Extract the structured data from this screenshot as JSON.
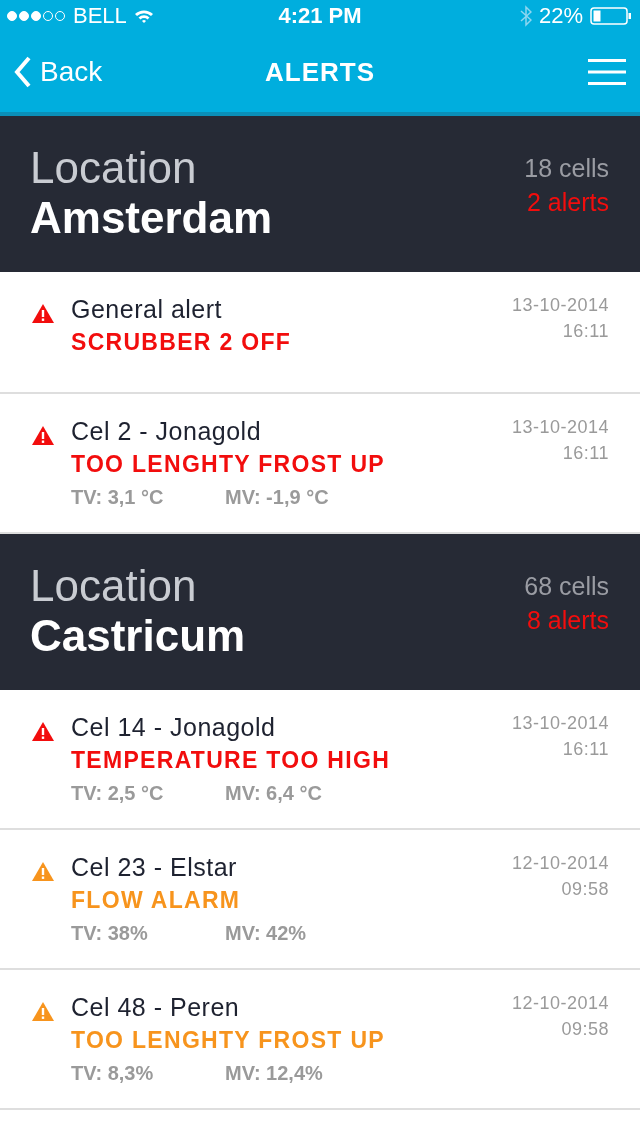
{
  "status_bar": {
    "carrier": "BELL",
    "time": "4:21 PM",
    "battery": "22%"
  },
  "nav": {
    "back": "Back",
    "title": "ALERTS"
  },
  "locations": [
    {
      "label": "Location",
      "name": "Amsterdam",
      "cells": "18 cells",
      "alerts": "2 alerts",
      "items": [
        {
          "kind": "critical",
          "title": "General alert",
          "message": "SCRUBBER 2 OFF",
          "date": "13-10-2014",
          "time": "16:11"
        },
        {
          "kind": "critical",
          "title": "Cel 2 - Jonagold",
          "message": "TOO LENGHTY FROST UP",
          "tv": "TV: 3,1 °C",
          "mv": "MV: -1,9 °C",
          "date": "13-10-2014",
          "time": "16:11"
        }
      ]
    },
    {
      "label": "Location",
      "name": "Castricum",
      "cells": "68 cells",
      "alerts": "8 alerts",
      "items": [
        {
          "kind": "critical",
          "title": "Cel 14 - Jonagold",
          "message": "TEMPERATURE TOO HIGH",
          "tv": "TV: 2,5 °C",
          "mv": "MV: 6,4 °C",
          "date": "13-10-2014",
          "time": "16:11"
        },
        {
          "kind": "warning",
          "title": "Cel 23 - Elstar",
          "message": "FLOW ALARM",
          "tv": "TV: 38%",
          "mv": "MV: 42%",
          "date": "12-10-2014",
          "time": "09:58"
        },
        {
          "kind": "warning",
          "title": "Cel 48 - Peren",
          "message": "TOO LENGHTY FROST UP",
          "tv": "TV: 8,3%",
          "mv": "MV: 12,4%",
          "date": "12-10-2014",
          "time": "09:58"
        }
      ]
    }
  ]
}
